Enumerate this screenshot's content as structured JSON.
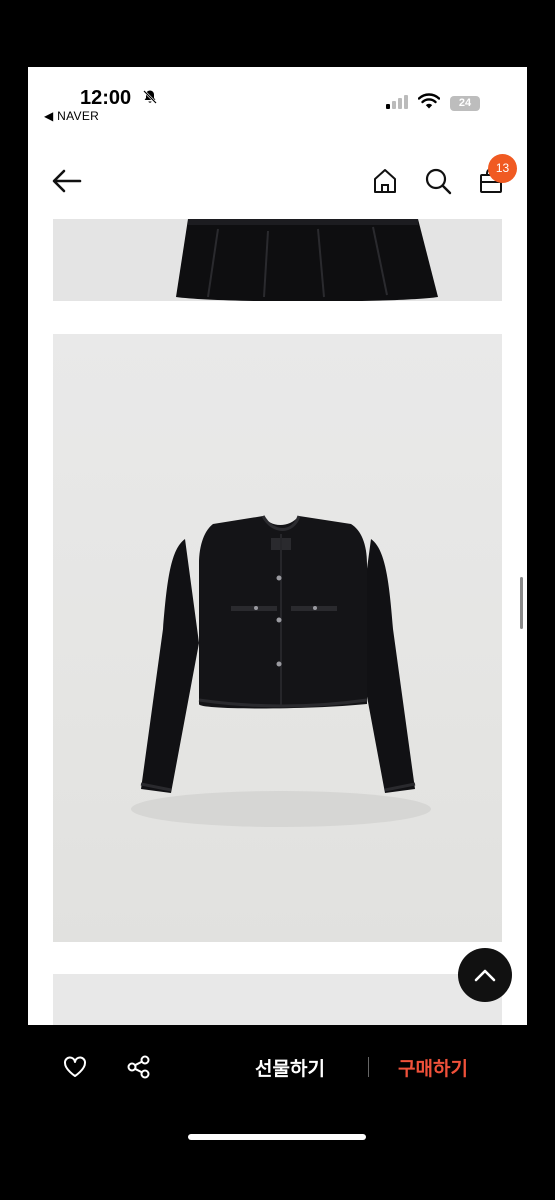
{
  "status_bar": {
    "time": "12:00",
    "back_app": "◀ NAVER",
    "battery": "24",
    "bell_icon": "bell-slash-icon",
    "signal_icon": "cellular-signal-icon",
    "wifi_icon": "wifi-icon"
  },
  "header": {
    "back_icon": "arrow-left-icon",
    "home_icon": "home-icon",
    "search_icon": "search-icon",
    "cart_icon": "shopping-bag-icon",
    "cart_count": "13",
    "badge_color": "#f05a22"
  },
  "product_images": {
    "top_icon": "product-image",
    "main_icon": "product-image",
    "next_icon": "product-image"
  },
  "scroll_top": {
    "icon": "chevron-up-icon"
  },
  "bottom_bar": {
    "like_icon": "heart-icon",
    "share_icon": "share-icon",
    "gift_label": "선물하기",
    "buy_label": "구매하기",
    "buy_color": "#f0513a"
  }
}
